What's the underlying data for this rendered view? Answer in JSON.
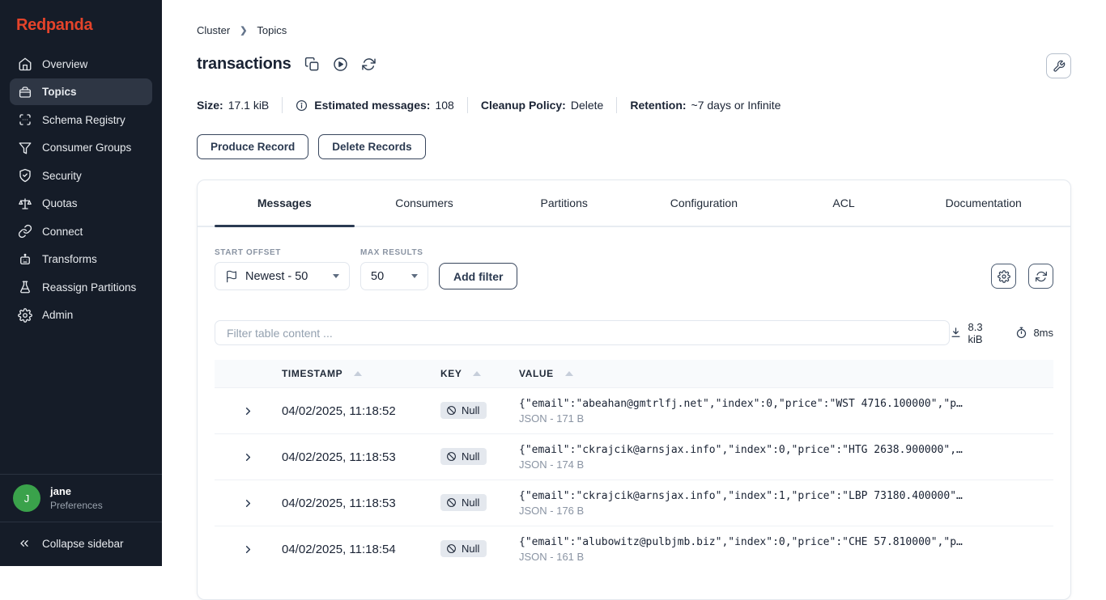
{
  "sidebar": {
    "logo": "Redpanda",
    "items": [
      {
        "label": "Overview",
        "icon": "home-icon"
      },
      {
        "label": "Topics",
        "icon": "box-icon",
        "active": true
      },
      {
        "label": "Schema Registry",
        "icon": "scan-icon"
      },
      {
        "label": "Consumer Groups",
        "icon": "funnel-icon"
      },
      {
        "label": "Security",
        "icon": "shield-icon"
      },
      {
        "label": "Quotas",
        "icon": "scales-icon"
      },
      {
        "label": "Connect",
        "icon": "link-icon"
      },
      {
        "label": "Transforms",
        "icon": "robot-icon"
      },
      {
        "label": "Reassign Partitions",
        "icon": "flask-icon"
      },
      {
        "label": "Admin",
        "icon": "gear-icon"
      }
    ],
    "user": {
      "initial": "J",
      "name": "jane",
      "subtitle": "Preferences"
    },
    "collapse_label": "Collapse sidebar"
  },
  "breadcrumb": {
    "item1": "Cluster",
    "item2": "Topics"
  },
  "header": {
    "title": "transactions"
  },
  "stats": {
    "size_label": "Size:",
    "size_value": "17.1 kiB",
    "messages_label": "Estimated messages:",
    "messages_value": "108",
    "cleanup_label": "Cleanup Policy:",
    "cleanup_value": "Delete",
    "retention_label": "Retention:",
    "retention_value": "~7 days or Infinite"
  },
  "actions": {
    "produce_label": "Produce Record",
    "delete_label": "Delete Records"
  },
  "tabs": [
    {
      "label": "Messages",
      "active": true
    },
    {
      "label": "Consumers"
    },
    {
      "label": "Partitions"
    },
    {
      "label": "Configuration"
    },
    {
      "label": "ACL"
    },
    {
      "label": "Documentation"
    }
  ],
  "filters": {
    "start_offset_label": "START OFFSET",
    "start_offset_value": "Newest - 50",
    "max_results_label": "MAX RESULTS",
    "max_results_value": "50",
    "add_filter_label": "Add filter"
  },
  "search": {
    "placeholder": "Filter table content ...",
    "payload_size": "8.3 kiB",
    "elapsed": "8ms"
  },
  "table": {
    "columns": {
      "timestamp": "TIMESTAMP",
      "key": "KEY",
      "value": "VALUE"
    },
    "rows": [
      {
        "timestamp": "04/02/2025, 11:18:52",
        "key": "Null",
        "value": "{\"email\":\"abeahan@gmtrlfj.net\",\"index\":0,\"price\":\"WST 4716.100000\",\"p…",
        "meta": "JSON - 171 B"
      },
      {
        "timestamp": "04/02/2025, 11:18:53",
        "key": "Null",
        "value": "{\"email\":\"ckrajcik@arnsjax.info\",\"index\":0,\"price\":\"HTG 2638.900000\",…",
        "meta": "JSON - 174 B"
      },
      {
        "timestamp": "04/02/2025, 11:18:53",
        "key": "Null",
        "value": "{\"email\":\"ckrajcik@arnsjax.info\",\"index\":1,\"price\":\"LBP 73180.400000\"…",
        "meta": "JSON - 176 B"
      },
      {
        "timestamp": "04/02/2025, 11:18:54",
        "key": "Null",
        "value": "{\"email\":\"alubowitz@pulbjmb.biz\",\"index\":0,\"price\":\"CHE 57.810000\",\"p…",
        "meta": "JSON - 161 B"
      }
    ]
  },
  "colors": {
    "logo": "#E4432A",
    "sidebar_bg": "#151C28",
    "sidebar_active_bg": "#2E3644",
    "accent_navy": "#2B3A52",
    "avatar_green": "#3AA24B",
    "null_badge_bg": "#E4E8EE",
    "table_header_bg": "#F8FAFC"
  }
}
